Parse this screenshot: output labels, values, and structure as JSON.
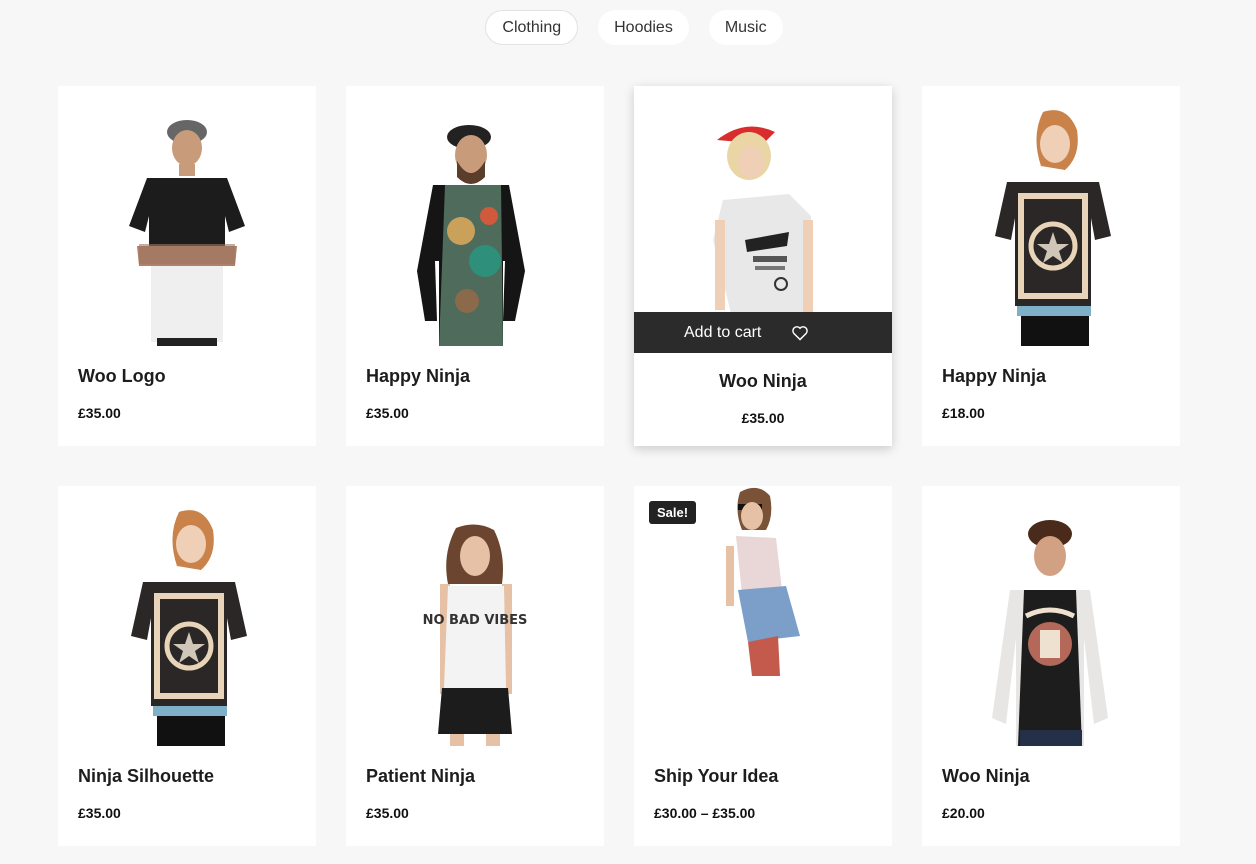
{
  "filters": [
    {
      "label": "Clothing",
      "active": true
    },
    {
      "label": "Hoodies",
      "active": false
    },
    {
      "label": "Music",
      "active": false
    }
  ],
  "products": [
    {
      "name": "Woo Logo",
      "price": "£35.00",
      "figure": "man-black-white-tee"
    },
    {
      "name": "Happy Ninja",
      "price": "£35.00",
      "figure": "man-raglan-print"
    },
    {
      "name": "Woo Ninja",
      "price": "£35.00",
      "figure": "woman-white-graphic-tee",
      "hovered": true
    },
    {
      "name": "Happy Ninja",
      "price": "£18.00",
      "figure": "woman-bandana-tee"
    },
    {
      "name": "Ninja Silhouette",
      "price": "£35.00",
      "figure": "woman-bandana-tee-2"
    },
    {
      "name": "Patient Ninja",
      "price": "£35.00",
      "figure": "woman-no-bad-vibes"
    },
    {
      "name": "Ship Your Idea",
      "price": "£30.00 – £35.00",
      "figure": "woman-denim-shorts",
      "sale": "Sale!"
    },
    {
      "name": "Woo Ninja",
      "price": "£20.00",
      "figure": "man-raglan-graphic"
    }
  ],
  "hover_actions": {
    "add_to_cart_label": "Add to cart",
    "wishlist_icon": "heart-icon"
  },
  "no_bad_vibes_text": "NO BAD VIBES"
}
